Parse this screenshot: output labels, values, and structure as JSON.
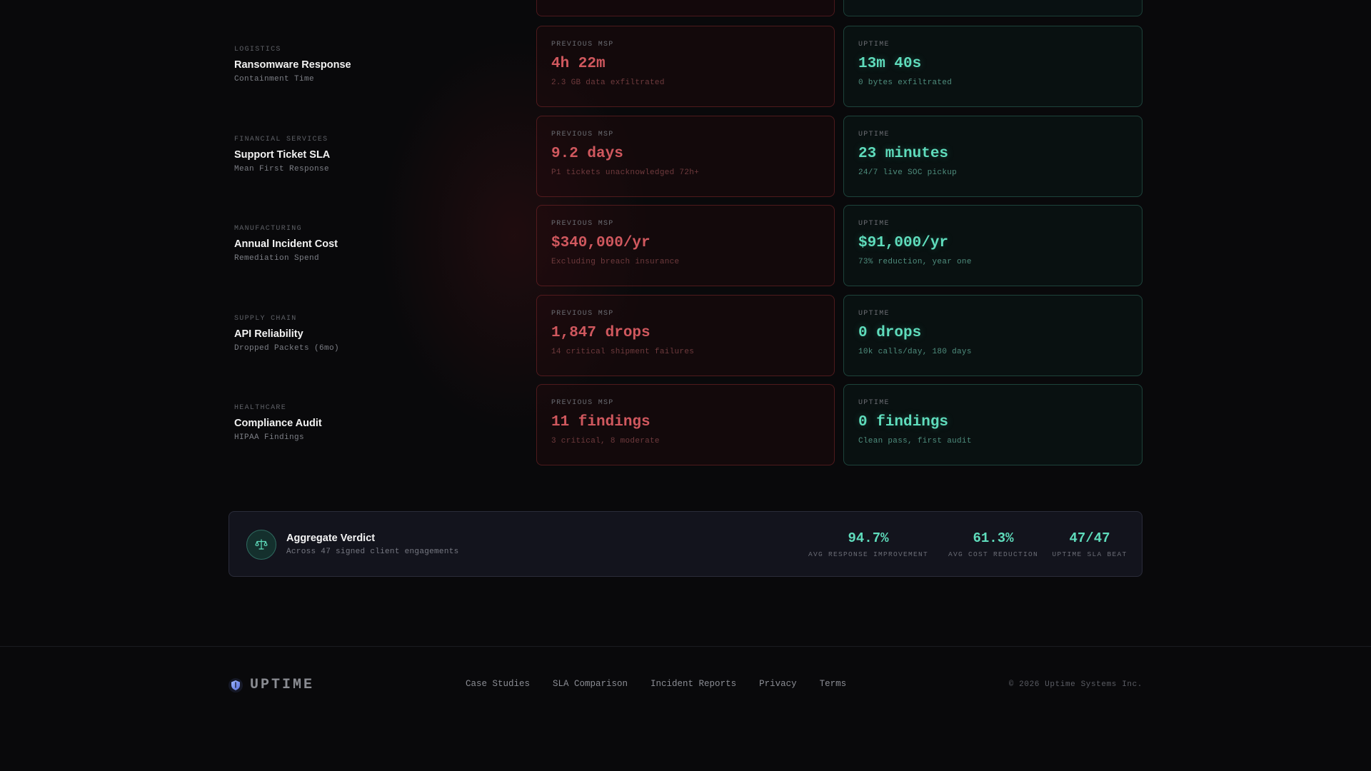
{
  "comparison": {
    "rows": [
      {
        "industry": "LOGISTICS",
        "title": "Ransomware Response",
        "subtitle": "Containment Time",
        "previous": {
          "label": "PREVIOUS MSP",
          "value": "4h 22m",
          "note": "2.3 GB data exfiltrated"
        },
        "uptime": {
          "label": "UPTIME",
          "value": "13m 40s",
          "note": "0 bytes exfiltrated"
        }
      },
      {
        "industry": "FINANCIAL SERVICES",
        "title": "Support Ticket SLA",
        "subtitle": "Mean First Response",
        "previous": {
          "label": "PREVIOUS MSP",
          "value": "9.2 days",
          "note": "P1 tickets unacknowledged 72h+"
        },
        "uptime": {
          "label": "UPTIME",
          "value": "23 minutes",
          "note": "24/7 live SOC pickup"
        }
      },
      {
        "industry": "MANUFACTURING",
        "title": "Annual Incident Cost",
        "subtitle": "Remediation Spend",
        "previous": {
          "label": "PREVIOUS MSP",
          "value": "$340,000/yr",
          "note": "Excluding breach insurance"
        },
        "uptime": {
          "label": "UPTIME",
          "value": "$91,000/yr",
          "note": "73% reduction, year one"
        }
      },
      {
        "industry": "SUPPLY CHAIN",
        "title": "API Reliability",
        "subtitle": "Dropped Packets (6mo)",
        "previous": {
          "label": "PREVIOUS MSP",
          "value": "1,847 drops",
          "note": "14 critical shipment failures"
        },
        "uptime": {
          "label": "UPTIME",
          "value": "0 drops",
          "note": "10k calls/day, 180 days"
        }
      },
      {
        "industry": "HEALTHCARE",
        "title": "Compliance Audit",
        "subtitle": "HIPAA Findings",
        "previous": {
          "label": "PREVIOUS MSP",
          "value": "11 findings",
          "note": "3 critical, 8 moderate"
        },
        "uptime": {
          "label": "UPTIME",
          "value": "0 findings",
          "note": "Clean pass, first audit"
        }
      }
    ]
  },
  "verdict": {
    "icon": "scale-icon",
    "title": "Aggregate Verdict",
    "subtitle": "Across 47 signed client engagements",
    "stats": [
      {
        "value": "94.7%",
        "label": "AVG RESPONSE IMPROVEMENT"
      },
      {
        "value": "61.3%",
        "label": "AVG COST REDUCTION"
      },
      {
        "value": "47/47",
        "label": "UPTIME SLA BEAT"
      }
    ]
  },
  "footer": {
    "brand": "UPTIME",
    "brand_icon": "shield-icon",
    "links": [
      "Case Studies",
      "SLA Comparison",
      "Incident Reports",
      "Privacy",
      "Terms"
    ],
    "copyright": "© 2026 Uptime Systems Inc."
  },
  "colors": {
    "background": "#09090b",
    "bad_accent": "#d0585e",
    "good_accent": "#5fdcbc",
    "verdict_bg": "#13141d"
  }
}
